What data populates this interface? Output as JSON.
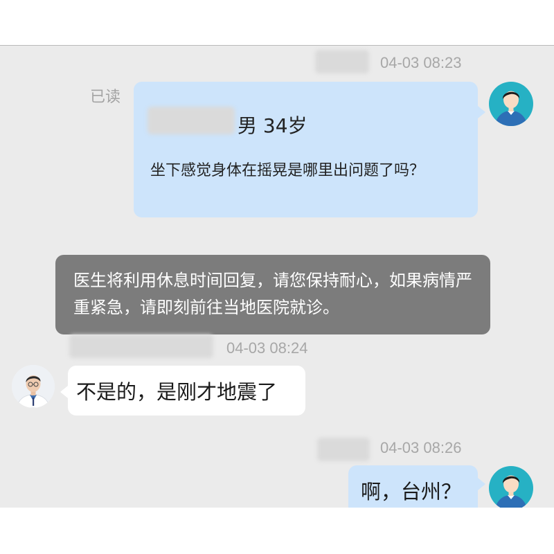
{
  "messages": {
    "first": {
      "timestamp": "04-03 08:23",
      "read_status": "已读",
      "patient_info": "男 34岁",
      "text": "坐下感觉身体在摇晃是哪里出问题了吗？"
    },
    "system_notice": {
      "text": "医生将利用休息时间回复，请您保持耐心，如果病情严重紧急，请即刻前往当地医院就诊。"
    },
    "second": {
      "timestamp": "04-03 08:24",
      "text": "不是的，是刚才地震了"
    },
    "third": {
      "timestamp": "04-03 08:26",
      "text": "啊，台州？"
    }
  },
  "colors": {
    "patient_bubble": "#cde4fb",
    "doctor_bubble": "#ffffff",
    "system_notice": "#7c7c7c",
    "avatar_teal": "#26b1c4",
    "chat_background": "#ebebeb"
  },
  "icons": {
    "patient_avatar": "patient-avatar-icon",
    "doctor_avatar": "doctor-photo-avatar"
  }
}
